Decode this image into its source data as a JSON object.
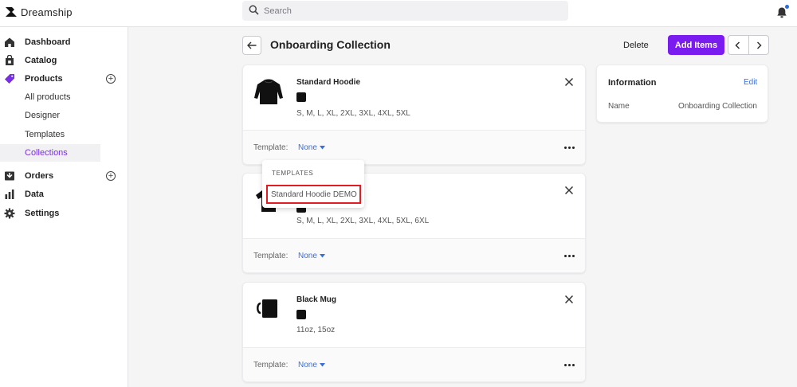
{
  "app": {
    "name": "Dreamship"
  },
  "search": {
    "placeholder": "Search"
  },
  "sidebar": {
    "dashboard": "Dashboard",
    "catalog": "Catalog",
    "products": "Products",
    "products_sub": [
      "All products",
      "Designer",
      "Templates",
      "Collections"
    ],
    "orders": "Orders",
    "data": "Data",
    "settings": "Settings"
  },
  "header": {
    "title": "Onboarding Collection",
    "delete_label": "Delete",
    "add_label": "Add Items"
  },
  "items": [
    {
      "name": "Standard Hoodie",
      "sizes": "S, M, L, XL, 2XL, 3XL, 4XL, 5XL",
      "template_label": "Template:",
      "template_value": "None"
    },
    {
      "name": "",
      "sizes": "S, M, L, XL, 2XL, 3XL, 4XL, 5XL, 6XL",
      "template_label": "Template:",
      "template_value": "None"
    },
    {
      "name": "Black Mug",
      "sizes": "11oz, 15oz",
      "template_label": "Template:",
      "template_value": "None"
    }
  ],
  "dropdown": {
    "header": "TEMPLATES",
    "option": "Standard Hoodie DEMO"
  },
  "info": {
    "title": "Information",
    "edit": "Edit",
    "name_key": "Name",
    "name_value": "Onboarding Collection"
  },
  "colors": {
    "accent": "#7a1cf0",
    "link": "#3a6ed8",
    "active_nav": "#7a2de6",
    "highlight": "#e31b23",
    "notification": "#2c6be0"
  }
}
